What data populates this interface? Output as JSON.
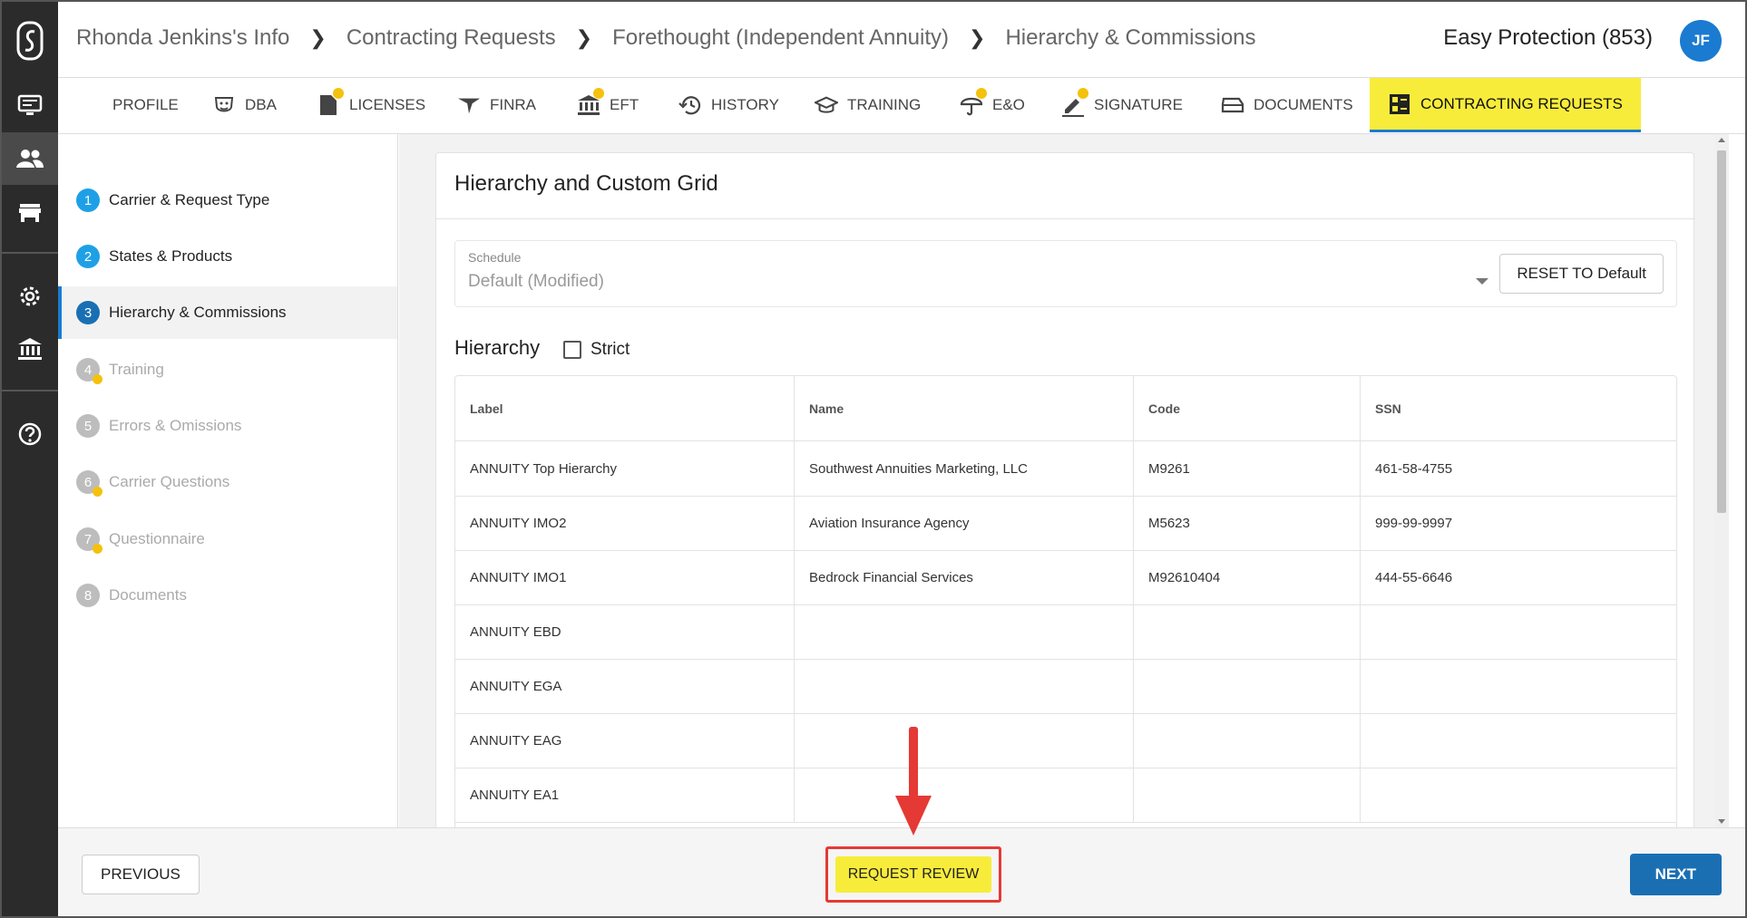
{
  "breadcrumb": [
    "Rhonda Jenkins's Info",
    "Contracting Requests",
    "Forethought (Independent Annuity)",
    "Hierarchy & Commissions"
  ],
  "header": {
    "org": "Easy Protection (853)",
    "avatar_initials": "JF",
    "avatar_color": "#1a7bd1"
  },
  "tabs": [
    {
      "label": "PROFILE",
      "icon": "profile",
      "dot": false
    },
    {
      "label": "DBA",
      "icon": "mask-icon",
      "dot": false
    },
    {
      "label": "LICENSES",
      "icon": "document-icon",
      "dot": true
    },
    {
      "label": "FINRA",
      "icon": "finra-icon",
      "dot": false
    },
    {
      "label": "EFT",
      "icon": "bank-icon",
      "dot": true
    },
    {
      "label": "HISTORY",
      "icon": "history-icon",
      "dot": false
    },
    {
      "label": "TRAINING",
      "icon": "graduation-cap-icon",
      "dot": false
    },
    {
      "label": "E&O",
      "icon": "umbrella-icon",
      "dot": true
    },
    {
      "label": "SIGNATURE",
      "icon": "pen-icon",
      "dot": true
    },
    {
      "label": "DOCUMENTS",
      "icon": "inbox-icon",
      "dot": false
    },
    {
      "label": "CONTRACTING REQUESTS",
      "icon": "grid-list-icon",
      "dot": false,
      "active": true
    }
  ],
  "steps": [
    {
      "num": "1",
      "label": "Carrier & Request Type",
      "state": "done"
    },
    {
      "num": "2",
      "label": "States & Products",
      "state": "done"
    },
    {
      "num": "3",
      "label": "Hierarchy & Commissions",
      "state": "active"
    },
    {
      "num": "4",
      "label": "Training",
      "state": "pending",
      "warn": true
    },
    {
      "num": "5",
      "label": "Errors & Omissions",
      "state": "pending"
    },
    {
      "num": "6",
      "label": "Carrier Questions",
      "state": "pending",
      "warn": true
    },
    {
      "num": "7",
      "label": "Questionnaire",
      "state": "pending",
      "warn": true
    },
    {
      "num": "8",
      "label": "Documents",
      "state": "pending"
    }
  ],
  "main": {
    "card_title": "Hierarchy and Custom Grid",
    "schedule_label": "Schedule",
    "schedule_value": "Default  (Modified)",
    "reset_label": "RESET TO Default",
    "hierarchy_title": "Hierarchy",
    "strict_label": "Strict",
    "columns": [
      "Label",
      "Name",
      "Code",
      "SSN"
    ],
    "rows": [
      [
        "ANNUITY Top Hierarchy",
        "Southwest Annuities Marketing, LLC",
        "M9261",
        "461-58-4755"
      ],
      [
        "ANNUITY IMO2",
        "Aviation Insurance Agency",
        "M5623",
        "999-99-9997"
      ],
      [
        "ANNUITY IMO1",
        "Bedrock Financial Services",
        "M92610404",
        "444-55-6646"
      ],
      [
        "ANNUITY EBD",
        "",
        "",
        ""
      ],
      [
        "ANNUITY EGA",
        "",
        "",
        ""
      ],
      [
        "ANNUITY EAG",
        "",
        "",
        ""
      ],
      [
        "ANNUITY EA1",
        "",
        "",
        ""
      ]
    ]
  },
  "footer": {
    "previous": "PREVIOUS",
    "request_review": "REQUEST REVIEW",
    "next": "NEXT"
  },
  "colors": {
    "accent_yellow": "#f8ec3b",
    "primary_blue": "#1a6fb3",
    "highlight_red": "#e53935"
  }
}
